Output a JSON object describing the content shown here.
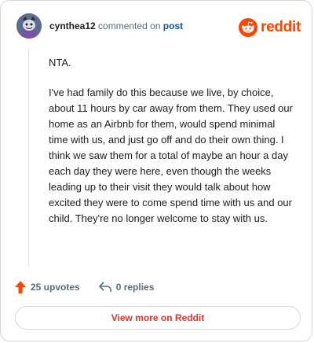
{
  "header": {
    "username": "cynthea12",
    "commented_text": "commented on",
    "post_link": "post",
    "logo_text": "reddit",
    "avatar_icon": "snoo-avatar-icon",
    "logo_icon": "reddit-alien-icon"
  },
  "comment": {
    "paragraphs": [
      "NTA.",
      "I've had family do this because we live, by choice, about 11 hours by car away from them. They used our home as an Airbnb for them, would spend minimal time with us, and just go off and do their own thing. I think we saw them for a total of maybe an hour a day each day they were here, even though the weeks leading up to their visit they would talk about how excited they were to come spend time with us and our child. They're no longer welcome to stay with us."
    ]
  },
  "actions": {
    "upvotes_label": "25 upvotes",
    "replies_label": "0 replies",
    "upvote_icon": "upvote-arrow-icon",
    "reply_icon": "reply-arrow-icon"
  },
  "footer": {
    "view_more_label": "View more on Reddit"
  },
  "colors": {
    "reddit_orange": "#ff4500",
    "link_blue": "#0a58a8",
    "muted_text": "#576f76",
    "view_more_red": "#e0352b"
  }
}
